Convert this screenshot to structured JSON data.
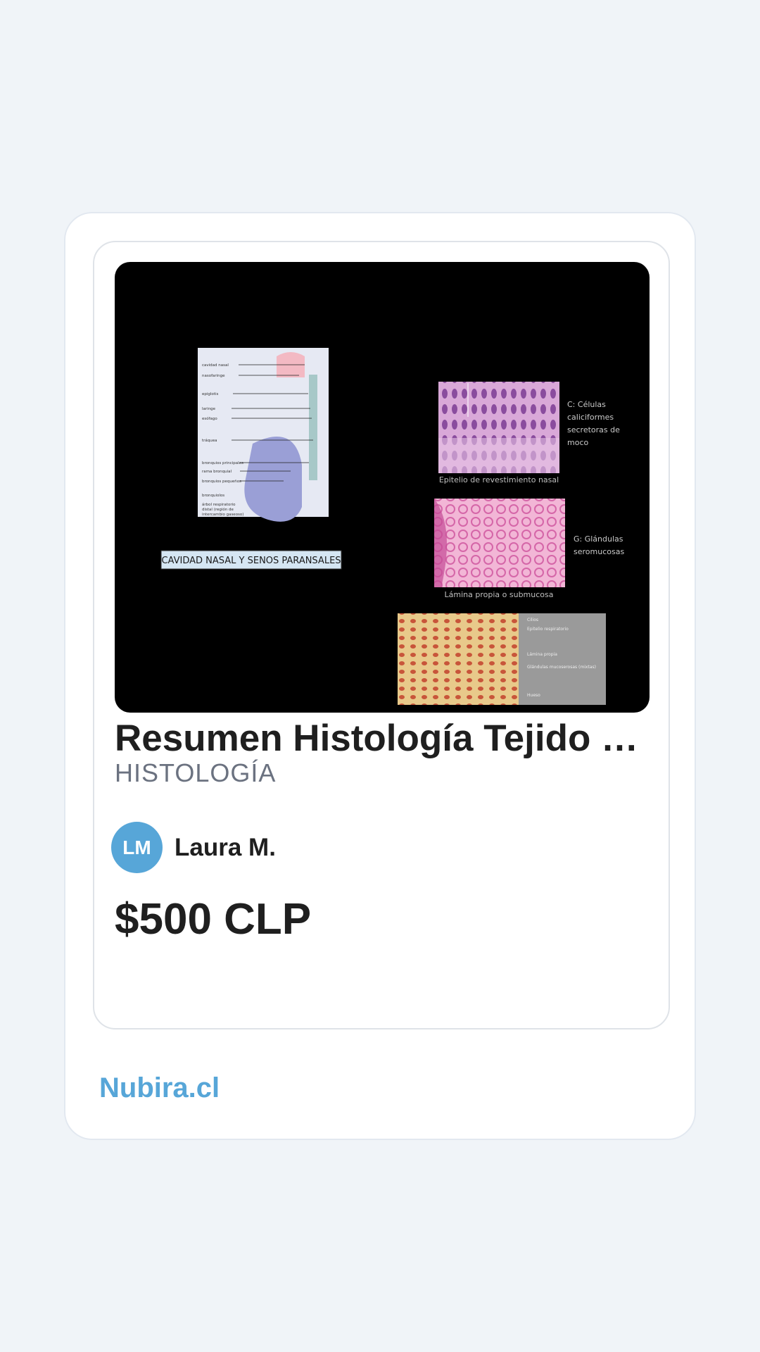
{
  "listing": {
    "title": "Resumen Histología Tejido p…",
    "subject": "HISTOLOGÍA",
    "author": {
      "initials": "LM",
      "name": "Laura M."
    },
    "price": "$500 CLP"
  },
  "thumbnail": {
    "banner": "CAVIDAD NASAL Y SENOS PARANSALES",
    "panel1_note": [
      "C: Células",
      "caliciformes",
      "secretoras de",
      "moco"
    ],
    "panel1_caption": "Epitelio de revestimiento nasal",
    "panel2_note": [
      "G: Glándulas",
      "seromucosas"
    ],
    "panel2_caption": "Lámina propia o submucosa",
    "panel3_labels": [
      "Cilios",
      "Epitelio respiratorio",
      "Lámina propia",
      "Glándulas mucoserosas (mixtas)",
      "Hueso"
    ],
    "diagram_labels": [
      "cavidad nasal",
      "nasofaringe",
      "epiglotis",
      "laringe",
      "esófago",
      "tráquea",
      "bronquios principales",
      "rama bronquial",
      "bronquios pequeños",
      "bronquiolos",
      "árbol respiratorio",
      "distal (región de",
      "intercambio gaseoso)"
    ]
  },
  "footer": {
    "brand": "Nubira.cl"
  },
  "colors": {
    "accent": "#57a6d8",
    "background": "#f0f4f8",
    "text": "#1f1f1f",
    "muted": "#6b7280"
  }
}
